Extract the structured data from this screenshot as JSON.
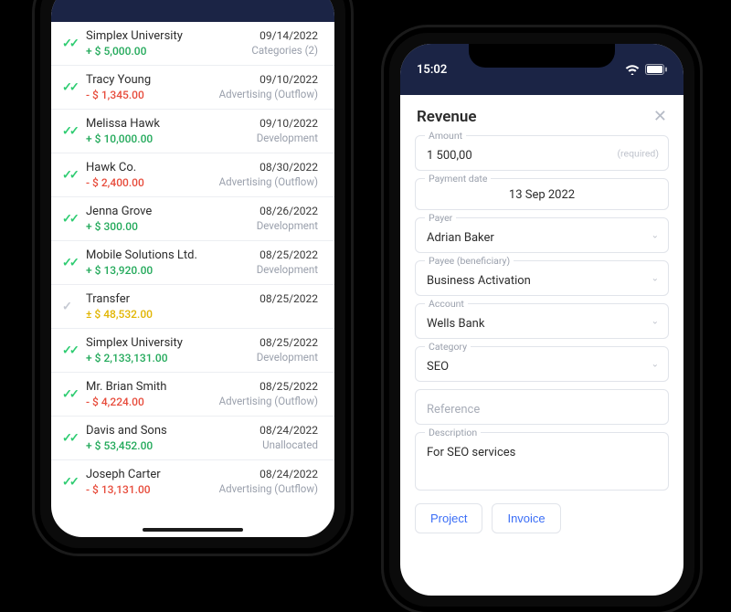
{
  "left": {
    "transactions": [
      {
        "name": "Simplex University",
        "amount": "+ $ 5,000.00",
        "amt_class": "pos",
        "date": "09/14/2022",
        "category": "Categories (2)",
        "icon_class": "green"
      },
      {
        "name": "Tracy Young",
        "amount": "- $ 1,345.00",
        "amt_class": "neg",
        "date": "09/10/2022",
        "category": "Advertising (Outflow)",
        "icon_class": "green"
      },
      {
        "name": "Melissa Hawk",
        "amount": "+ $ 10,000.00",
        "amt_class": "pos",
        "date": "09/10/2022",
        "category": "Development",
        "icon_class": "green"
      },
      {
        "name": "Hawk Co.",
        "amount": "- $ 2,400.00",
        "amt_class": "neg",
        "date": "08/30/2022",
        "category": "Advertising (Outflow)",
        "icon_class": "green"
      },
      {
        "name": "Jenna Grove",
        "amount": "+ $ 300.00",
        "amt_class": "pos",
        "date": "08/26/2022",
        "category": "Development",
        "icon_class": "green"
      },
      {
        "name": "Mobile Solutions Ltd.",
        "amount": "+ $ 13,920.00",
        "amt_class": "pos",
        "date": "08/25/2022",
        "category": "Development",
        "icon_class": "green"
      },
      {
        "name": "Transfer",
        "amount": "± $ 48,532.00",
        "amt_class": "yel",
        "date": "08/25/2022",
        "category": "",
        "icon_class": "gray"
      },
      {
        "name": "Simplex University",
        "amount": "+ $ 2,133,131.00",
        "amt_class": "pos",
        "date": "08/25/2022",
        "category": "Development",
        "icon_class": "green"
      },
      {
        "name": "Mr. Brian Smith",
        "amount": "- $ 4,224.00",
        "amt_class": "neg",
        "date": "08/25/2022",
        "category": "Advertising (Outflow)",
        "icon_class": "green"
      },
      {
        "name": "Davis and Sons",
        "amount": "+ $ 53,452.00",
        "amt_class": "pos",
        "date": "08/24/2022",
        "category": "Unallocated",
        "icon_class": "green"
      },
      {
        "name": "Joseph Carter",
        "amount": "- $ 13,131.00",
        "amt_class": "neg",
        "date": "08/24/2022",
        "category": "Advertising (Outflow)",
        "icon_class": "green"
      }
    ]
  },
  "right": {
    "time": "15:02",
    "title": "Revenue",
    "amount": {
      "label": "Amount",
      "value": "1 500,00",
      "required_hint": "(required)"
    },
    "payment_date": {
      "label": "Payment date",
      "value": "13 Sep 2022"
    },
    "payer": {
      "label": "Payer",
      "value": "Adrian Baker"
    },
    "payee": {
      "label": "Payee (beneficiary)",
      "value": "Business Activation"
    },
    "account": {
      "label": "Account",
      "value": "Wells Bank"
    },
    "category": {
      "label": "Category",
      "value": "SEO"
    },
    "reference": {
      "placeholder": "Reference"
    },
    "description": {
      "label": "Description",
      "value": "For SEO services"
    },
    "buttons": {
      "project": "Project",
      "invoice": "Invoice"
    }
  }
}
